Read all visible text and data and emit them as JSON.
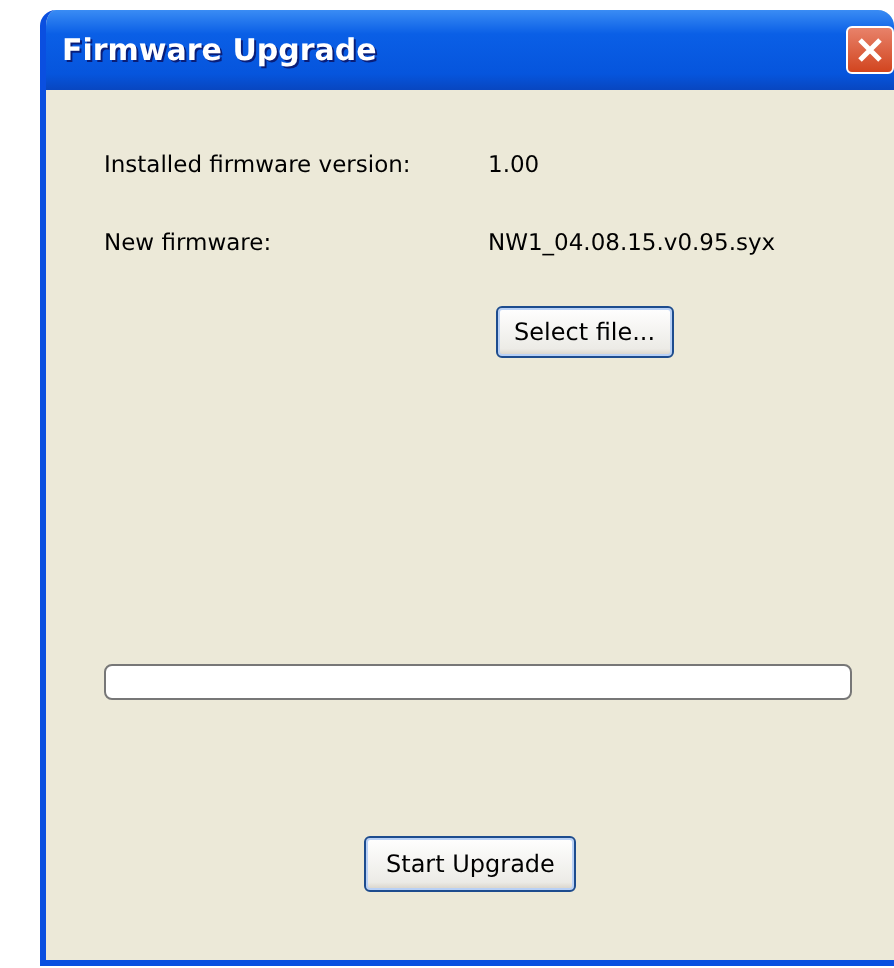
{
  "window": {
    "title": "Firmware Upgrade"
  },
  "fields": [
    {
      "label": "Installed firmware version:",
      "value": "1.00"
    },
    {
      "label": "New firmware:",
      "value": "NW1_04.08.15.v0.95.syx"
    }
  ],
  "select_button": "Select file...",
  "start_button": "Start Upgrade"
}
